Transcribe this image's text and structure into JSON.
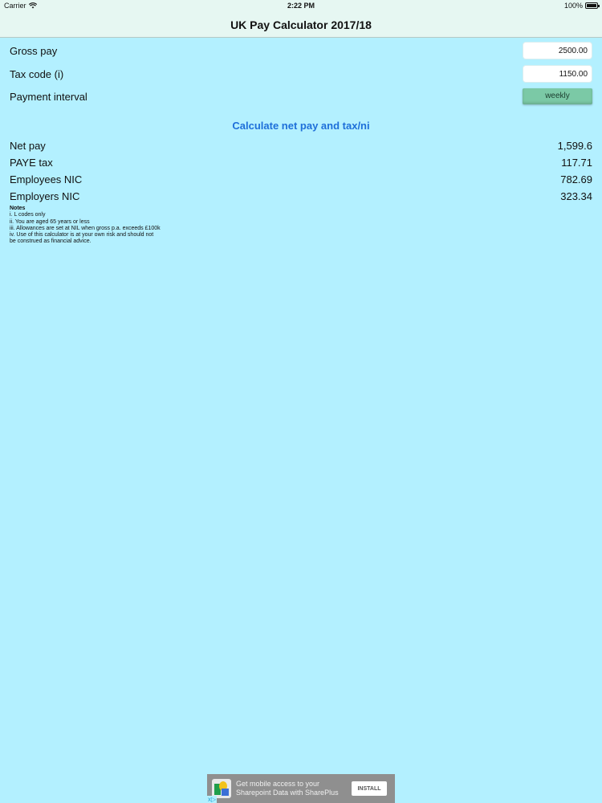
{
  "status_bar": {
    "carrier": "Carrier",
    "time": "2:22 PM",
    "battery": "100%"
  },
  "nav": {
    "title": "UK Pay Calculator 2017/18"
  },
  "inputs": {
    "gross_pay": {
      "label": "Gross pay",
      "value": "2500.00"
    },
    "tax_code": {
      "label": "Tax code (i)",
      "value": "1150.00"
    },
    "payment_interval": {
      "label": "Payment interval",
      "value": "weekly"
    }
  },
  "calculate_label": "Calculate net pay and tax/ni",
  "results": [
    {
      "label": "Net pay",
      "value": "1,599.6"
    },
    {
      "label": "PAYE tax",
      "value": "117.71"
    },
    {
      "label": "Employees NIC",
      "value": "782.69"
    },
    {
      "label": "Employers NIC",
      "value": "323.34"
    }
  ],
  "notes": {
    "title": "Notes",
    "lines": [
      "i. L codes only",
      "ii. You are aged 65 years or less",
      "iii. Allowances are set at NIL when gross p.a. exceeds £100k",
      "iv. Use of this calculator is at your own risk and should not",
      "be construed as financial advice."
    ]
  },
  "ad": {
    "text_line1": "Get mobile access to your",
    "text_line2": "Sharepoint Data with SharePlus",
    "install_label": "INSTALL",
    "choices": "x▷"
  },
  "colors": {
    "background": "#b3f0ff",
    "nav_background": "#e6f7f2",
    "accent_link": "#1e6fd9",
    "picker_green": "#7bc9a6"
  }
}
